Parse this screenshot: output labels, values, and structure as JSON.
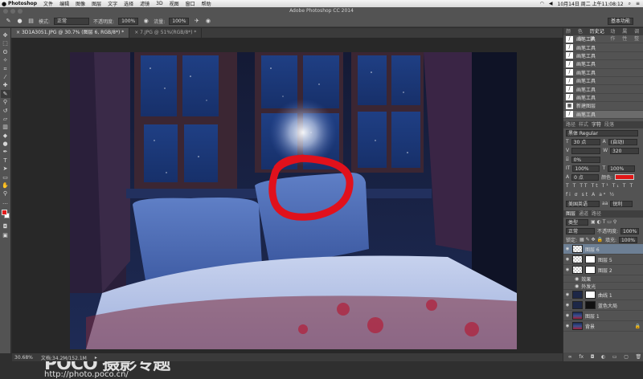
{
  "menubar": {
    "app": "Photoshop",
    "items": [
      "文件",
      "编辑",
      "图像",
      "图层",
      "文字",
      "选择",
      "滤镜",
      "3D",
      "视图",
      "窗口",
      "帮助"
    ],
    "clock": "10月14日 周二 上午11:08:12"
  },
  "title": "Adobe Photoshop CC 2014",
  "options": {
    "mode_label": "模式:",
    "mode_value": "正常",
    "opacity_label": "不透明度:",
    "opacity_value": "100%",
    "flow_label": "流量:",
    "flow_value": "100%",
    "workspace": "基本功能"
  },
  "tabs": [
    {
      "label": "3D1A3051.JPG @ 30.7% (图层 6, RGB/8*) *",
      "active": true
    },
    {
      "label": "7.JPG @ 51%(RGB/8*) *",
      "active": false
    }
  ],
  "status": {
    "zoom": "30.68%",
    "doc": "文档:34.2M/152.1M"
  },
  "watermark": {
    "logo": "POCO 摄影专题",
    "url": "http://photo.poco.cn/"
  },
  "history": {
    "tabs": [
      "颜色",
      "色板",
      "历史记录",
      "动作",
      "属性",
      "调整"
    ],
    "items": [
      {
        "label": "画笔工具",
        "active": false
      },
      {
        "label": "画笔工具",
        "active": false
      },
      {
        "label": "画笔工具",
        "active": false
      },
      {
        "label": "画笔工具",
        "active": false
      },
      {
        "label": "画笔工具",
        "active": false
      },
      {
        "label": "画笔工具",
        "active": false
      },
      {
        "label": "画笔工具",
        "active": false
      },
      {
        "label": "画笔工具",
        "active": false
      },
      {
        "label": "新建图层",
        "active": false
      },
      {
        "label": "画笔工具",
        "active": true
      }
    ]
  },
  "character": {
    "tabs": [
      "路径",
      "样式",
      "字符",
      "段落"
    ],
    "font": "黑体 Regular",
    "size": "30 点",
    "leading": "(自动)",
    "tracking": "320",
    "scale": "0%",
    "v_scale": "100%",
    "h_scale": "100%",
    "baseline": "0 点",
    "color_label": "颜色:",
    "color": "#e01616",
    "lang": "美国英语",
    "aa": "锐利"
  },
  "layers": {
    "tabs": [
      "图层",
      "通道",
      "路径"
    ],
    "filter": "类型",
    "blend": "正常",
    "opacity_label": "不透明度:",
    "opacity": "100%",
    "lock_label": "锁定:",
    "fill_label": "填充:",
    "fill": "100%",
    "items": [
      {
        "name": "图层 6",
        "thumb": "check",
        "active": true
      },
      {
        "name": "图层 5",
        "thumb": "check",
        "active": false
      },
      {
        "name": "图层 2",
        "thumb": "check",
        "active": false
      },
      {
        "name": "效果",
        "thumb": "none",
        "active": false
      },
      {
        "name": "外发光",
        "thumb": "none",
        "active": false
      },
      {
        "name": "曲线 1",
        "thumb": "dark",
        "active": false
      },
      {
        "name": "蓝色大局",
        "thumb": "dark",
        "active": false
      },
      {
        "name": "图层 1",
        "thumb": "photo",
        "active": false
      },
      {
        "name": "背景",
        "thumb": "photo",
        "active": false
      }
    ]
  }
}
